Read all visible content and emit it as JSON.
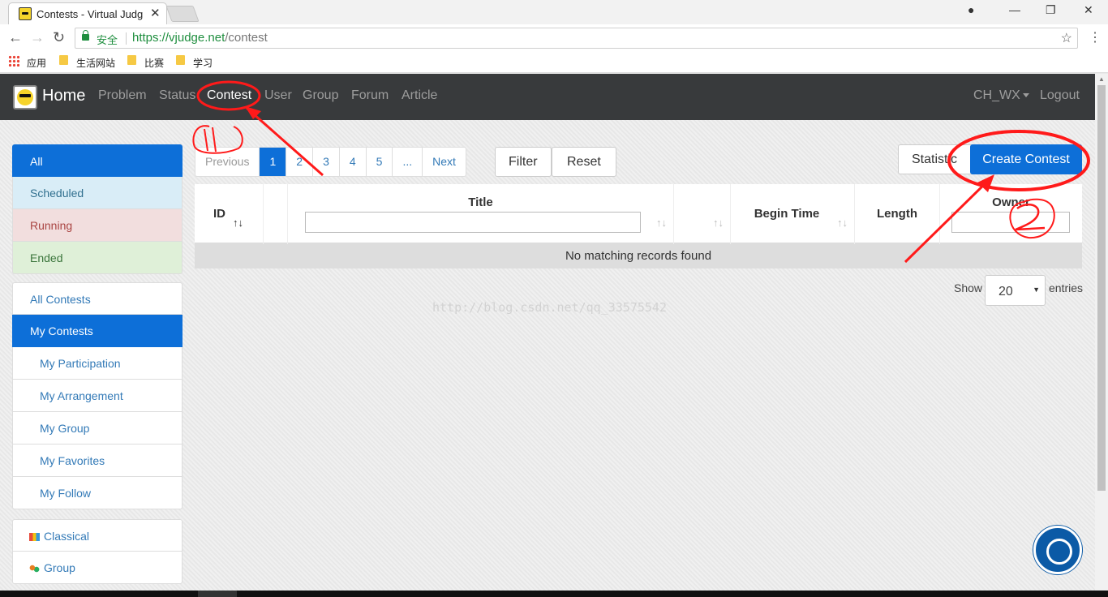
{
  "browser": {
    "tab_title": "Contests - Virtual Judg",
    "close_glyph": "✕",
    "url_secure_label": "安全",
    "url_host": "https://vjudge.net",
    "url_path": "/contest",
    "bookmarks": [
      "应用",
      "生活网站",
      "比赛",
      "学习"
    ]
  },
  "navbar": {
    "brand": "Home",
    "links": [
      "Problem",
      "Status",
      "Contest",
      "User",
      "Group",
      "Forum",
      "Article"
    ],
    "active": "Contest",
    "user": "CH_WX",
    "logout": "Logout"
  },
  "sidebar": {
    "status_filters": [
      "All",
      "Scheduled",
      "Running",
      "Ended"
    ],
    "contest_groups": {
      "all": "All Contests",
      "mine": "My Contests",
      "sub_items": [
        "My Participation",
        "My Arrangement",
        "My Group",
        "My Favorites",
        "My Follow"
      ]
    },
    "types": [
      "Classical",
      "Group"
    ]
  },
  "pagination": {
    "previous": "Previous",
    "pages": [
      "1",
      "2",
      "3",
      "4",
      "5",
      "..."
    ],
    "next": "Next",
    "current": "1"
  },
  "buttons": {
    "filter": "Filter",
    "reset": "Reset",
    "statistics": "Statistic",
    "create": "Create Contest"
  },
  "table": {
    "columns": [
      "ID",
      "Title",
      "Begin Time",
      "Length",
      "Owner"
    ],
    "empty_message": "No matching records found"
  },
  "page_size": {
    "show": "Show",
    "value": "20",
    "entries": "entries"
  },
  "watermark": "http://blog.csdn.net/qq_33575542",
  "colors": {
    "navbar": "#383a3c",
    "primary": "#0d6fd8",
    "annotation": "#ff1a1a"
  }
}
